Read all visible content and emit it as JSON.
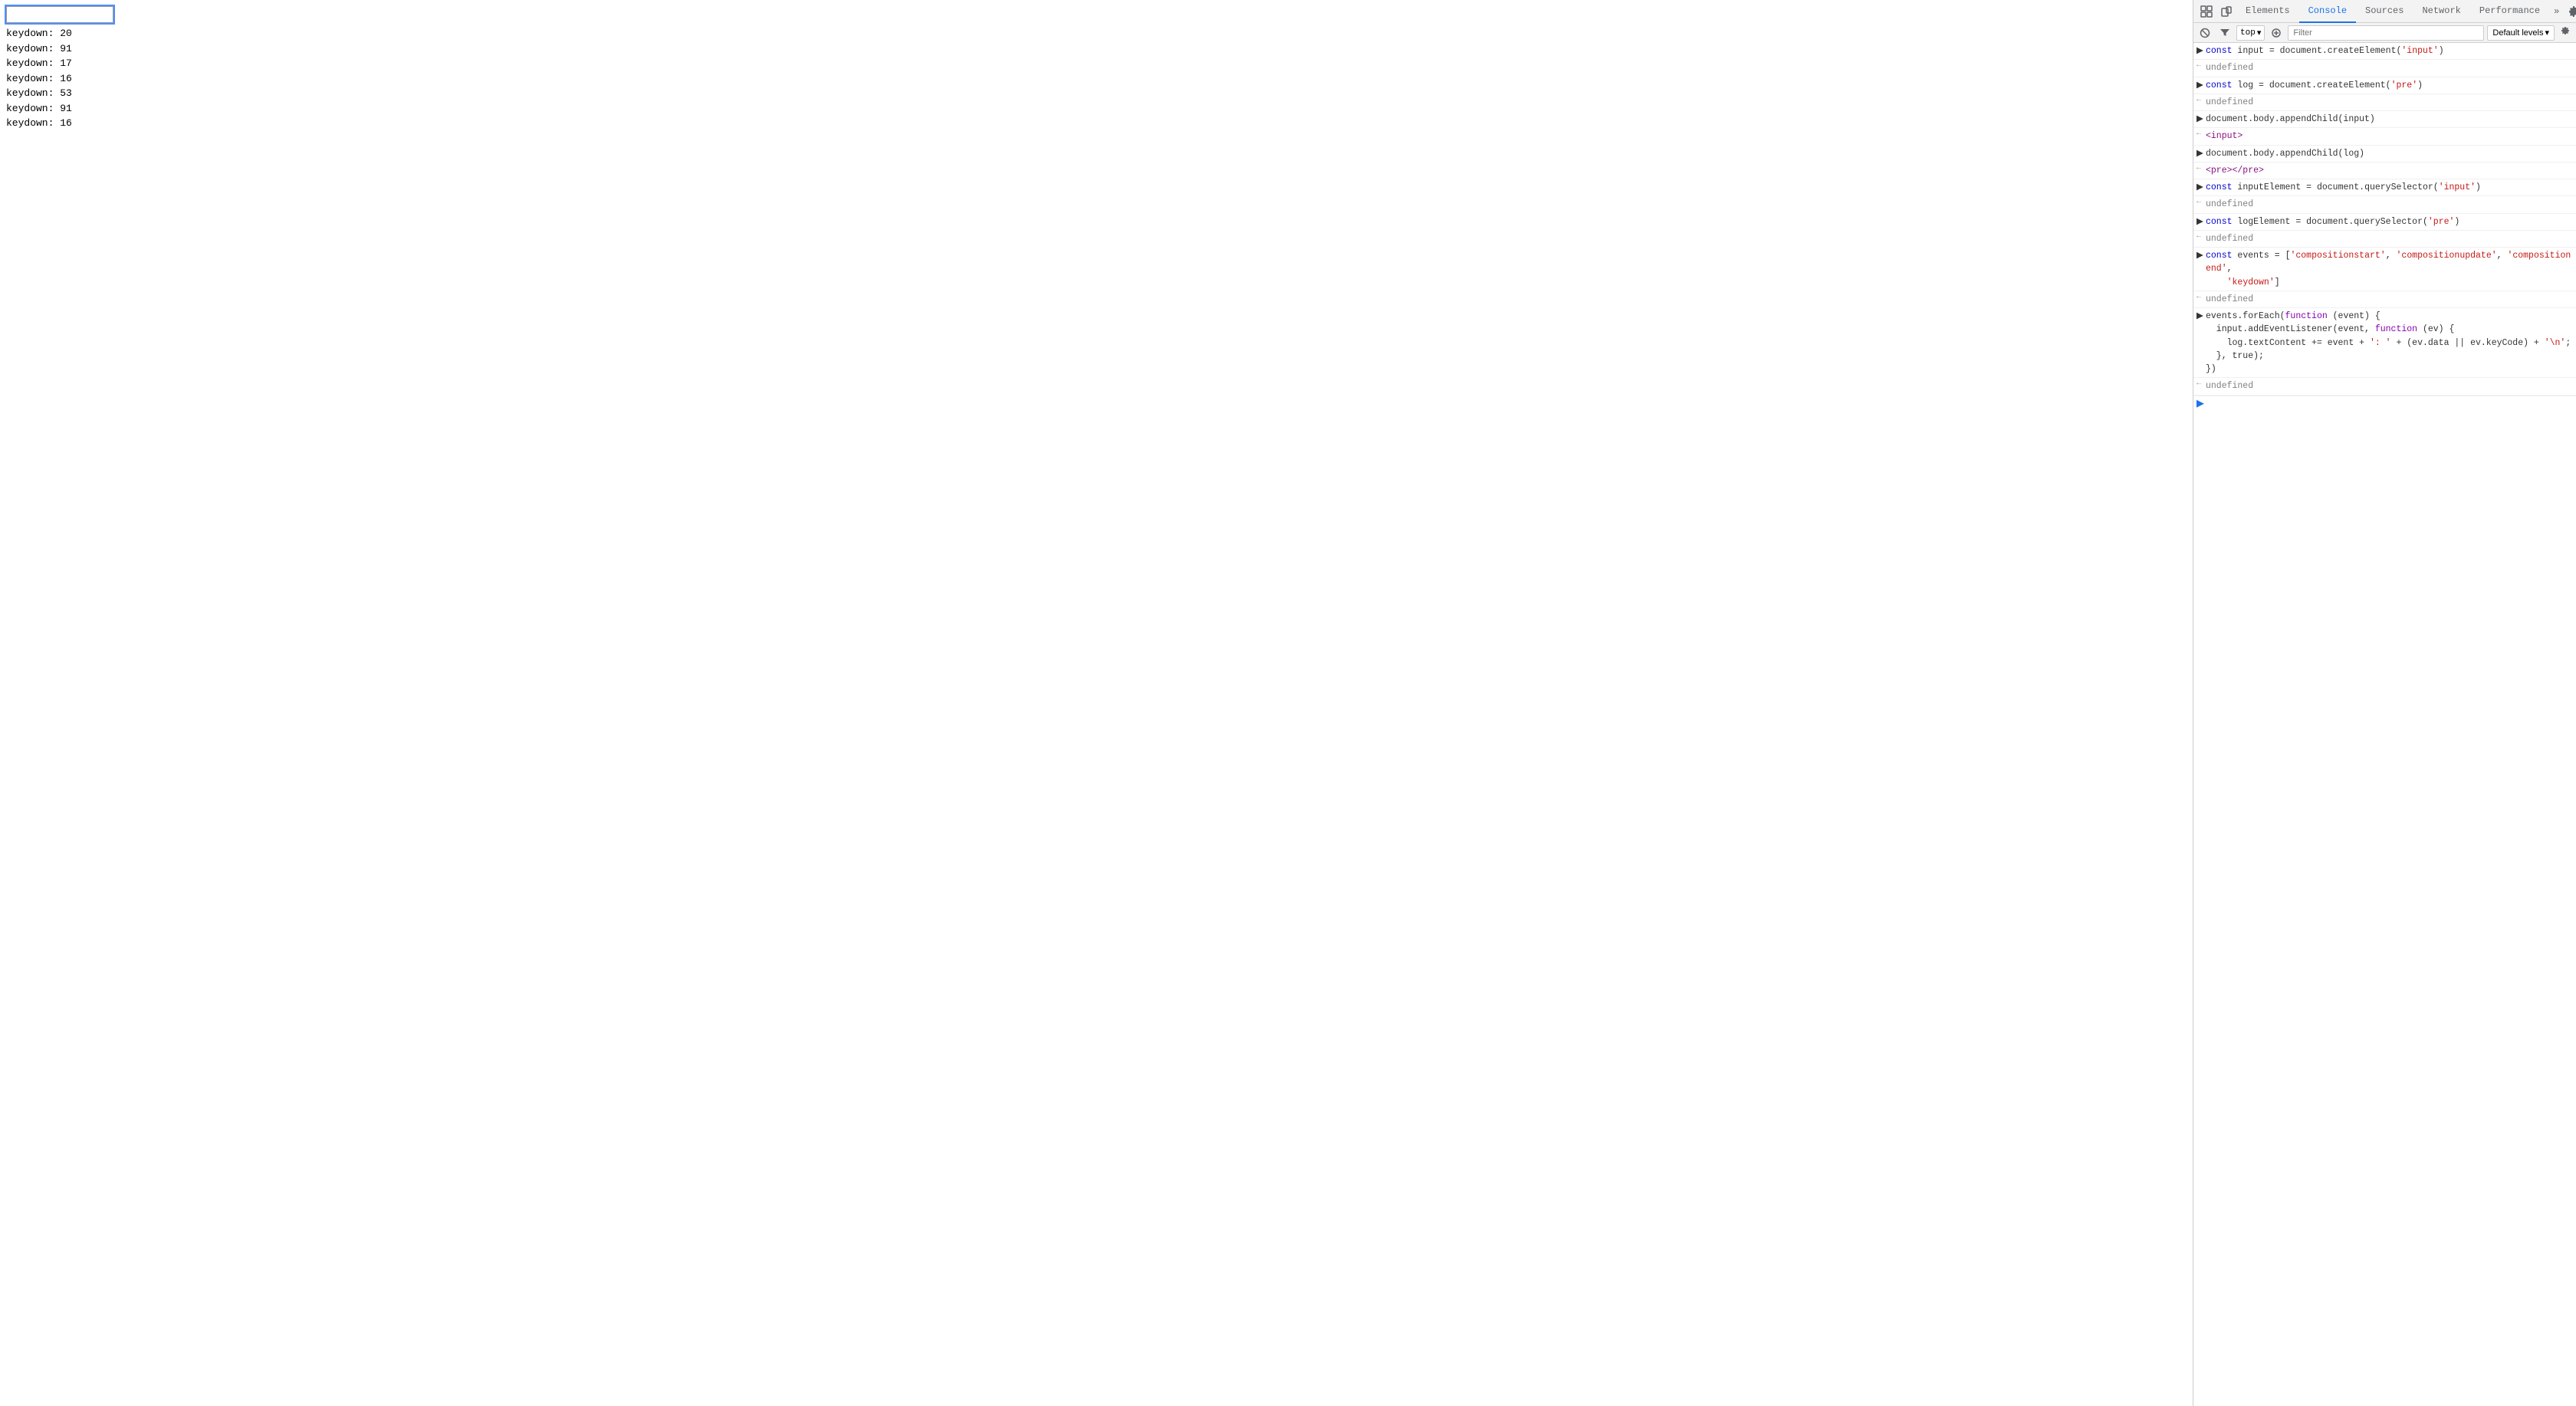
{
  "page": {
    "input_value": "",
    "log_text": "keydown: 20\nkeydown: 91\nkeydown: 17\nkeydown: 16\nkeydown: 53\nkeydown: 91\nkeydown: 16"
  },
  "devtools": {
    "tabs": [
      {
        "label": "Elements",
        "active": false
      },
      {
        "label": "Console",
        "active": true
      },
      {
        "label": "Sources",
        "active": false
      },
      {
        "label": "Network",
        "active": false
      },
      {
        "label": "Performance",
        "active": false
      }
    ],
    "more_tabs_label": "»",
    "context": "top",
    "filter_placeholder": "Filter",
    "levels_label": "Default levels",
    "console_entries": [
      {
        "type": "expression",
        "arrow": "▶",
        "content": "const input = document.createElement('input')"
      },
      {
        "type": "return",
        "arrow": "←",
        "content": "undefined"
      },
      {
        "type": "expression",
        "arrow": "▶",
        "content": "const log = document.createElement('pre')"
      },
      {
        "type": "return",
        "arrow": "←",
        "content": "undefined"
      },
      {
        "type": "expression",
        "arrow": "▶",
        "content": "document.body.appendChild(input)"
      },
      {
        "type": "return_tag",
        "arrow": "←",
        "content": "<input>"
      },
      {
        "type": "expression",
        "arrow": "▶",
        "content": "document.body.appendChild(log)"
      },
      {
        "type": "return_tag",
        "arrow": "←",
        "content": "<pre></pre>"
      },
      {
        "type": "expression",
        "arrow": "▶",
        "content": "const inputElement = document.querySelector('input')"
      },
      {
        "type": "return",
        "arrow": "←",
        "content": "undefined"
      },
      {
        "type": "expression",
        "arrow": "▶",
        "content": "const logElement = document.querySelector('pre')"
      },
      {
        "type": "return",
        "arrow": "←",
        "content": "undefined"
      },
      {
        "type": "expression",
        "arrow": "▶",
        "content": "const events = ['compositionstart', 'compositionupdate', 'compositionend', 'keydown']"
      },
      {
        "type": "return",
        "arrow": "←",
        "content": "undefined"
      },
      {
        "type": "expression_block",
        "arrow": "▶",
        "lines": [
          "events.forEach(function (event) {",
          "  input.addEventListener(event, function (ev) {",
          "    log.textContent += event + ': ' + (ev.data || ev.keyCode) + '\\n';",
          "  }, true);",
          "})"
        ]
      },
      {
        "type": "return",
        "arrow": "←",
        "content": "undefined"
      }
    ]
  }
}
